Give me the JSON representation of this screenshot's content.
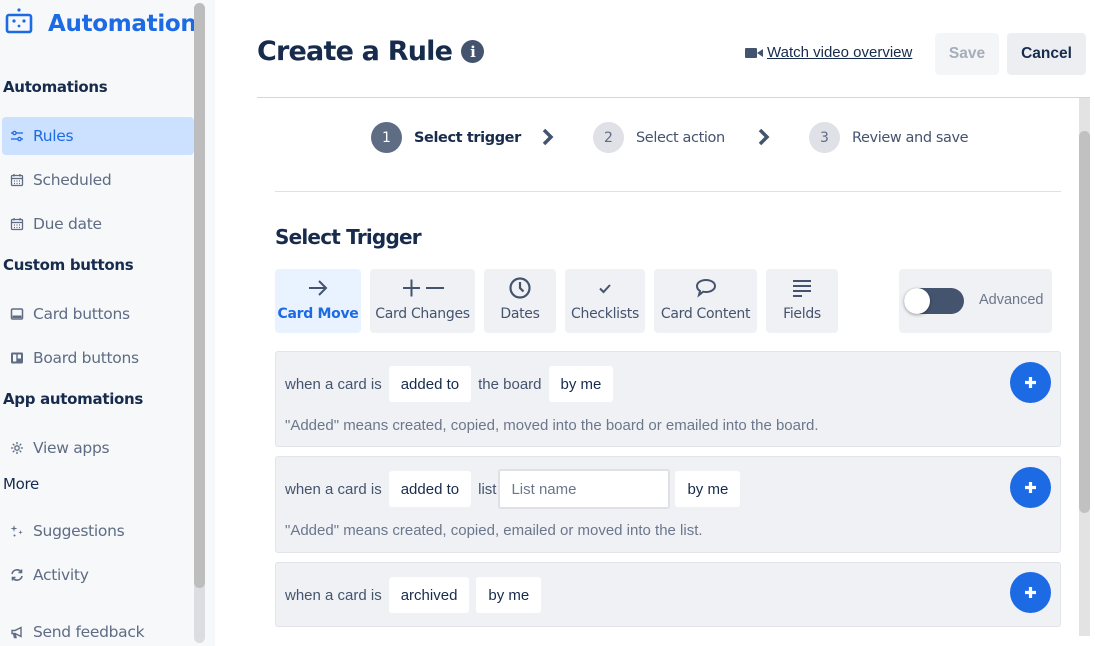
{
  "app": {
    "title": "Automation",
    "brand_color": "#1d6ae5"
  },
  "sidebar": {
    "sections": [
      {
        "title": "Automations"
      },
      {
        "title": "Custom buttons"
      },
      {
        "title": "App automations"
      },
      {
        "title": "More"
      }
    ],
    "items": [
      {
        "label": "Rules",
        "icon": "sliders-icon",
        "active": true
      },
      {
        "label": "Scheduled",
        "icon": "calendar-icon",
        "active": false
      },
      {
        "label": "Due date",
        "icon": "calendar-icon",
        "active": false
      },
      {
        "label": "Card buttons",
        "icon": "card-icon",
        "active": false
      },
      {
        "label": "Board buttons",
        "icon": "board-icon",
        "active": false
      },
      {
        "label": "View apps",
        "icon": "gear-icon",
        "active": false
      },
      {
        "label": "Suggestions",
        "icon": "sparkle-icon",
        "active": false
      },
      {
        "label": "Activity",
        "icon": "refresh-icon",
        "active": false
      },
      {
        "label": "Send feedback",
        "icon": "megaphone-icon",
        "active": false
      }
    ]
  },
  "header": {
    "title": "Create a Rule",
    "info_icon_glyph": "i",
    "watch_video_label": "Watch video overview",
    "save_label": "Save",
    "cancel_label": "Cancel"
  },
  "stepper": {
    "steps": [
      {
        "number": "1",
        "label": "Select trigger",
        "active": true
      },
      {
        "number": "2",
        "label": "Select action",
        "active": false
      },
      {
        "number": "3",
        "label": "Review and save",
        "active": false
      }
    ]
  },
  "trigger_section": {
    "heading": "Select Trigger",
    "tabs": [
      {
        "label": "Card Move",
        "icon": "arrow-right-icon",
        "active": true
      },
      {
        "label": "Card Changes",
        "icon": "plus-minus-icon",
        "active": false
      },
      {
        "label": "Dates",
        "icon": "clock-icon",
        "active": false
      },
      {
        "label": "Checklists",
        "icon": "checkmark-icon",
        "active": false
      },
      {
        "label": "Card Content",
        "icon": "comment-icon",
        "active": false
      },
      {
        "label": "Fields",
        "icon": "lines-icon",
        "active": false
      }
    ],
    "advanced": {
      "label": "Advanced",
      "enabled": false
    },
    "triggers": [
      {
        "prefix": "when a card is",
        "action": "added to",
        "middle": "the board",
        "actor": "by me",
        "note": "\"Added\" means created, copied, moved into the board or emailed into the board."
      },
      {
        "prefix": "when a card is",
        "action": "added to",
        "middle": "list",
        "list_placeholder": "List name",
        "list_value": "",
        "actor": "by me",
        "note": "\"Added\" means created, copied, emailed or moved into the list."
      },
      {
        "prefix": "when a card is",
        "action": "archived",
        "actor": "by me"
      }
    ]
  }
}
